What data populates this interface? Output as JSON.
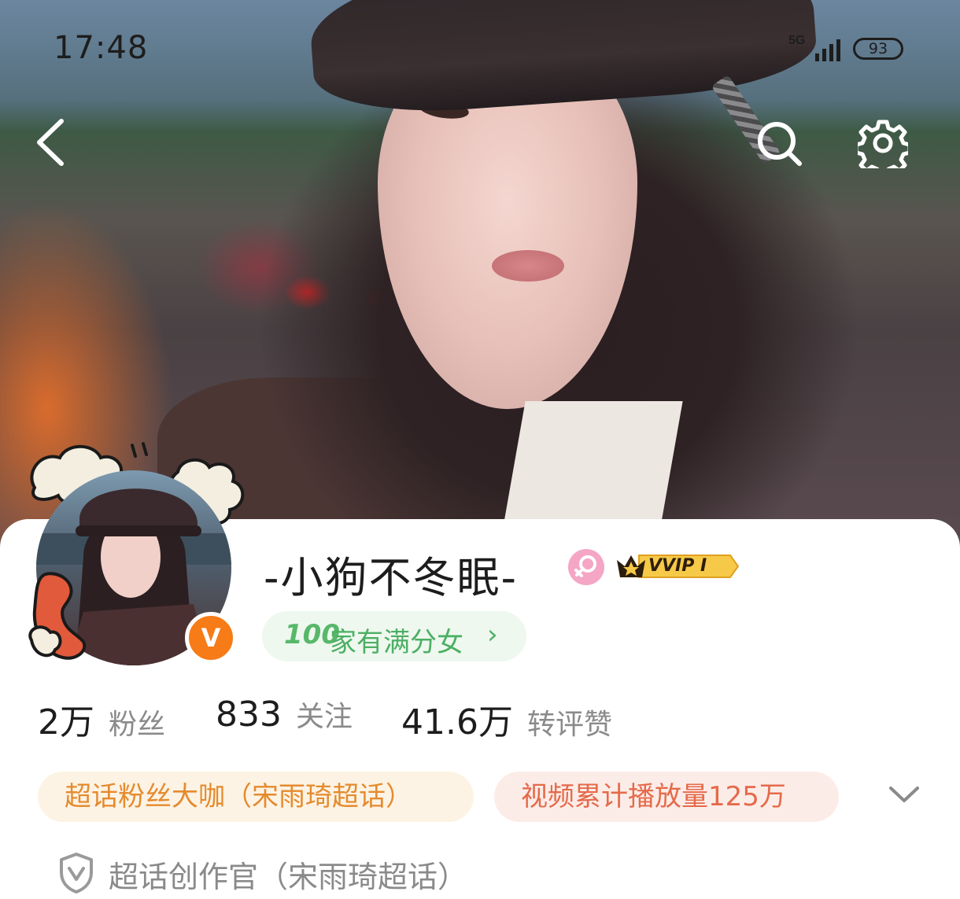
{
  "status_bar": {
    "time": "17:48",
    "network": "5G",
    "battery": "93"
  },
  "nav": {
    "back_icon": "chevron-left-icon",
    "search_icon": "search-icon",
    "settings_icon": "gear-icon"
  },
  "profile": {
    "name": "-小狗不冬眠-",
    "gender_icon": "female-icon",
    "vip_badge": "VVIP I",
    "verified_mark": "V",
    "family_chip": {
      "icon_text": "100",
      "label": "家有满分女",
      "arrow": "›"
    }
  },
  "stats": [
    {
      "value": "2万",
      "label": "粉丝"
    },
    {
      "value": "833",
      "label": "关注"
    },
    {
      "value": "41.6万",
      "label": "转评赞"
    }
  ],
  "tags": [
    {
      "label": "超话粉丝大咖（宋雨琦超话）"
    },
    {
      "label": "视频累计播放量125万"
    }
  ],
  "creator": {
    "icon": "shield-icon",
    "label": "超话创作官（宋雨琦超话）"
  },
  "colors": {
    "accent_orange": "#f77b16",
    "green_chip": "#4caf63",
    "tag1_text": "#e48b2e",
    "tag2_text": "#e56a4a",
    "vip_gold": "#f7c948"
  }
}
